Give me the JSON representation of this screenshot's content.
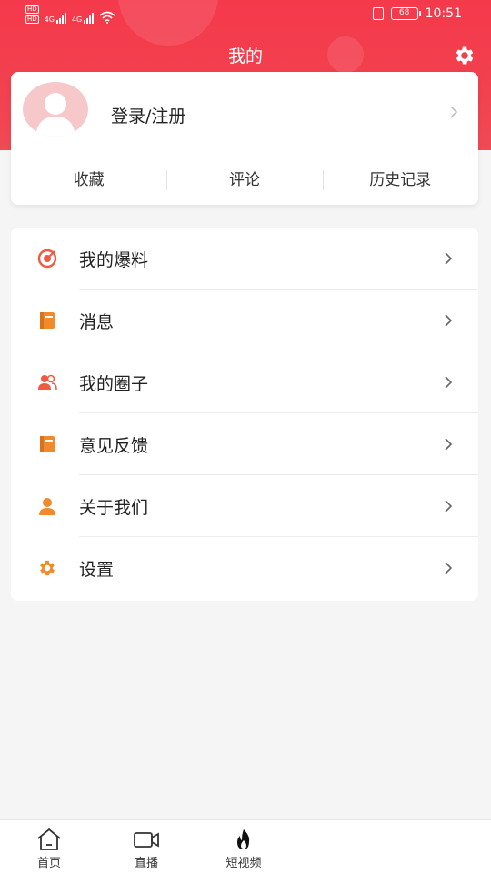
{
  "status_bar": {
    "time": "10:51",
    "battery": "68",
    "network_1": "4G",
    "network_2": "4G"
  },
  "header": {
    "title": "我的",
    "accent_color": "#f23d4d"
  },
  "profile": {
    "login_label": "登录/注册"
  },
  "quick_links": [
    {
      "label": "收藏"
    },
    {
      "label": "评论"
    },
    {
      "label": "历史记录"
    }
  ],
  "menu": [
    {
      "label": "我的爆料",
      "icon": "target-icon",
      "color": "#ef5a44"
    },
    {
      "label": "消息",
      "icon": "message-book-icon",
      "color": "#f08a2a"
    },
    {
      "label": "我的圈子",
      "icon": "group-people-icon",
      "color": "#ef5a44"
    },
    {
      "label": "意见反馈",
      "icon": "feedback-book-icon",
      "color": "#f08a2a"
    },
    {
      "label": "关于我们",
      "icon": "person-icon",
      "color": "#f08a2a"
    },
    {
      "label": "设置",
      "icon": "gear-icon",
      "color": "#f08a2a"
    }
  ],
  "bottom_nav": [
    {
      "label": "首页",
      "icon": "home-icon"
    },
    {
      "label": "直播",
      "icon": "video-camera-icon"
    },
    {
      "label": "短视频",
      "icon": "flame-icon"
    }
  ]
}
